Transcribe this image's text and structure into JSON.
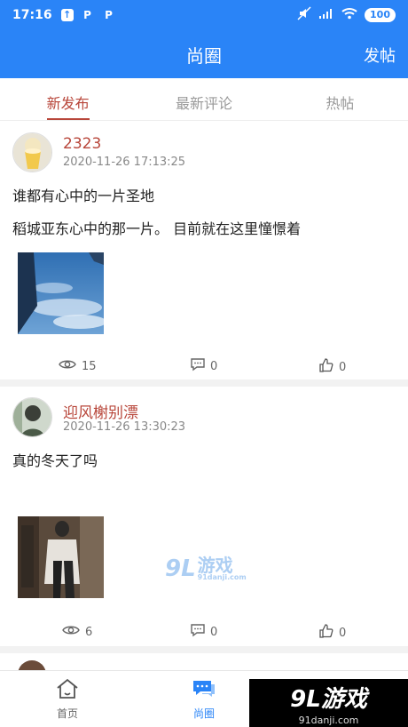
{
  "status_bar": {
    "time": "17:16",
    "battery": "100"
  },
  "app_bar": {
    "title": "尚圈",
    "post_button": "发帖"
  },
  "tabs": [
    {
      "label": "新发布",
      "active": true
    },
    {
      "label": "最新评论",
      "active": false
    },
    {
      "label": "热帖",
      "active": false
    }
  ],
  "posts": [
    {
      "username": "2323",
      "datetime": "2020-11-26 17:13:25",
      "title": "谁都有心中的一片圣地",
      "body": "稻城亚东心中的那一片。 目前就在这里憧憬着",
      "views": "15",
      "comments": "0",
      "likes": "0"
    },
    {
      "username": "迎风榭别漂",
      "datetime": "2020-11-26 13:30:23",
      "title": "真的冬天了吗",
      "body": "",
      "views": "6",
      "comments": "0",
      "likes": "0"
    }
  ],
  "watermark": {
    "mark": "9L",
    "text": "游戏",
    "domain": "91danji.com"
  },
  "bottom_nav": [
    {
      "label": "首页",
      "icon": "home-icon",
      "active": false
    },
    {
      "label": "尚圈",
      "icon": "chat-icon",
      "active": true
    }
  ],
  "corner_logo": {
    "line1": "9L游戏",
    "line2": "91danji.com"
  },
  "colors": {
    "primary": "#2a84f7",
    "accent": "#b8463a"
  }
}
